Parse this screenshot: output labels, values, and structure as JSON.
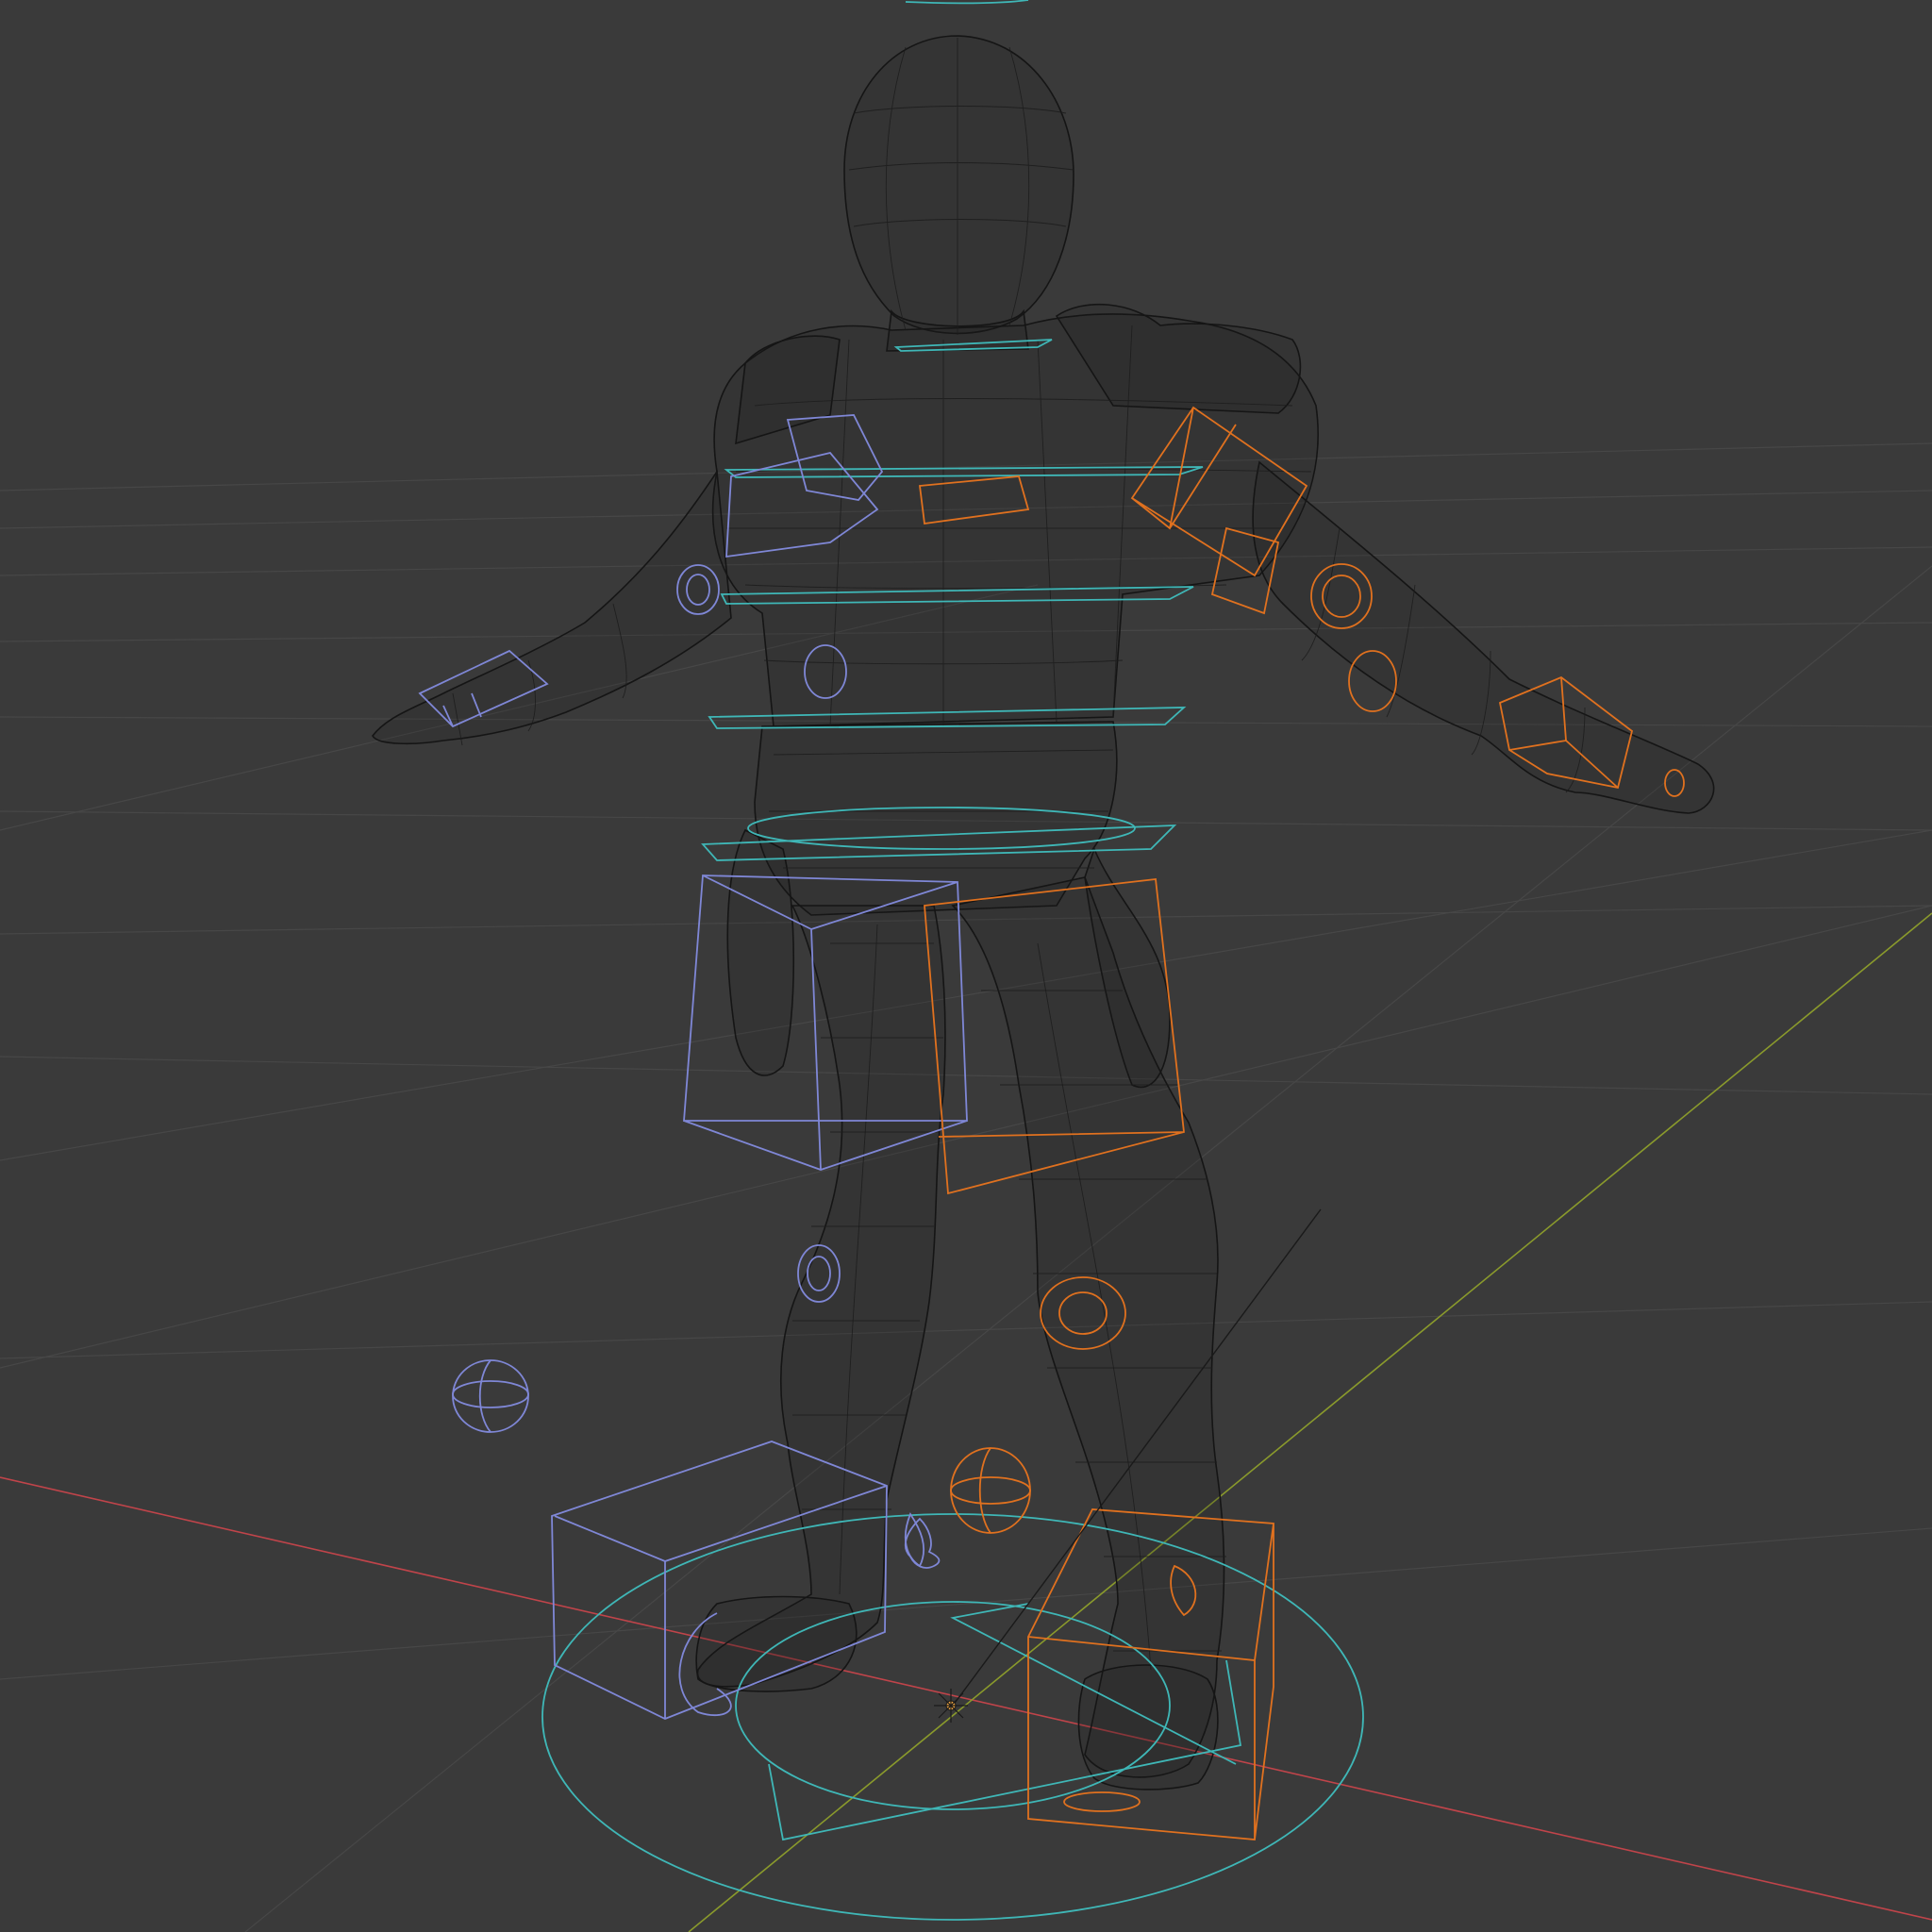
{
  "viewport": {
    "mode": "wireframe",
    "colors": {
      "background": "#3a3a3a",
      "grid": "#474747",
      "x_axis": "#c0444a",
      "y_axis": "#8a9a2c",
      "mesh": "#151515",
      "left_controls": "#7f87d6",
      "right_controls": "#e0711f",
      "center_controls": "#3fb7b7"
    },
    "icons": {
      "origin": "origin-marker-icon",
      "empty": "empty-object-icon"
    }
  }
}
